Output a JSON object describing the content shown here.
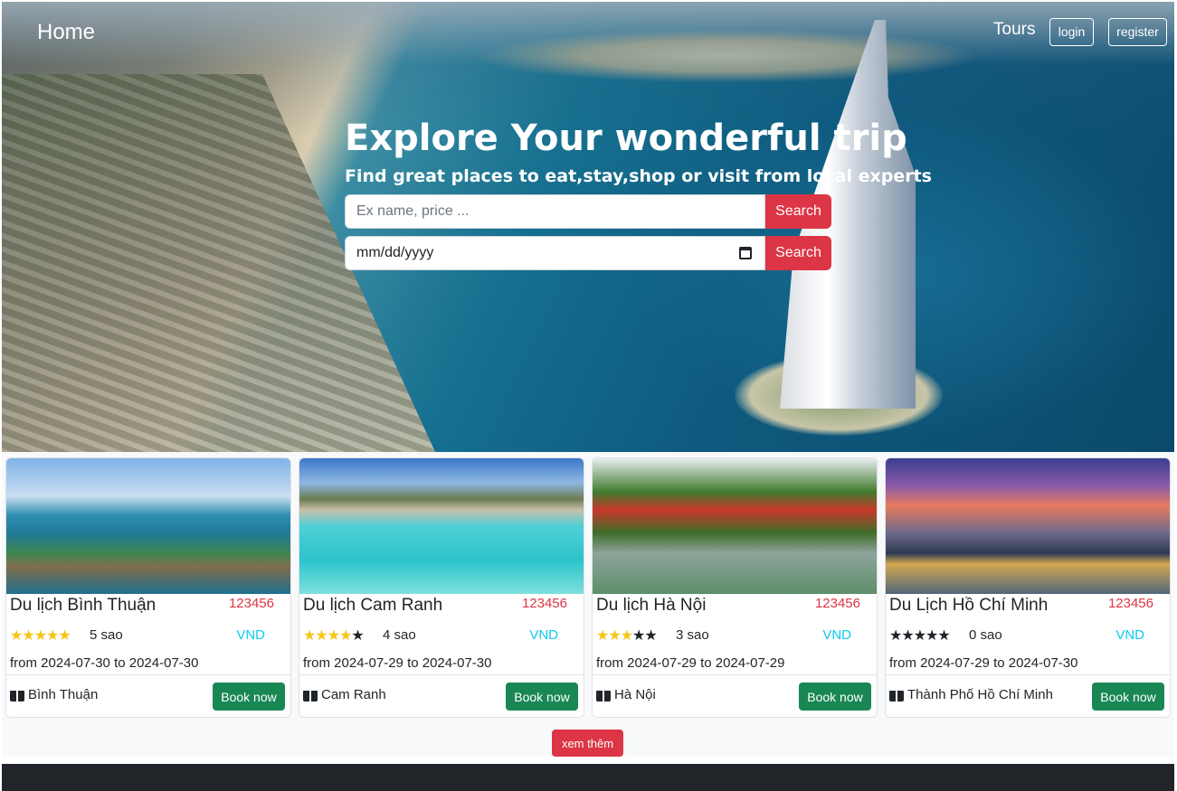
{
  "navbar": {
    "brand": "Home",
    "tours_label": "Tours",
    "login_label": "login",
    "register_label": "register"
  },
  "hero": {
    "title": "Explore Your wonderful trip",
    "subtitle": "Find great places to eat,stay,shop or visit from local experts",
    "search_placeholder": "Ex name, price ...",
    "search_button": "Search",
    "date_value": "mm/dd/yyyy",
    "date_search_button": "Search"
  },
  "tours": [
    {
      "title": "Du lịch Bình Thuận",
      "price": "123456",
      "stars": 5,
      "rating": "5 sao",
      "currency": "VND",
      "dates": "from 2024-07-30 to 2024-07-30",
      "location": "Bình Thuận",
      "book": "Book now"
    },
    {
      "title": "Du lịch Cam Ranh",
      "price": "123456",
      "stars": 4,
      "rating": "4 sao",
      "currency": "VND",
      "dates": "from 2024-07-29 to 2024-07-30",
      "location": "Cam Ranh",
      "book": "Book now"
    },
    {
      "title": "Du lịch Hà Nội",
      "price": "123456",
      "stars": 3,
      "rating": "3 sao",
      "currency": "VND",
      "dates": "from 2024-07-29 to 2024-07-29",
      "location": "Hà Nội",
      "book": "Book now"
    },
    {
      "title": "Du Lịch Hồ Chí Minh",
      "price": "123456",
      "stars": 0,
      "rating": "0 sao",
      "currency": "VND",
      "dates": "from 2024-07-29 to 2024-07-30",
      "location": "Thành Phố Hồ Chí Minh",
      "book": "Book now"
    }
  ],
  "more_button": "xem thêm",
  "colors": {
    "danger": "#dc3545",
    "success": "#198754",
    "info": "#0dcaf0",
    "star": "#f5c518",
    "footer": "#212529"
  },
  "icons": {
    "location": "book-open-icon",
    "rating": "star-icon",
    "date": "calendar-icon"
  }
}
